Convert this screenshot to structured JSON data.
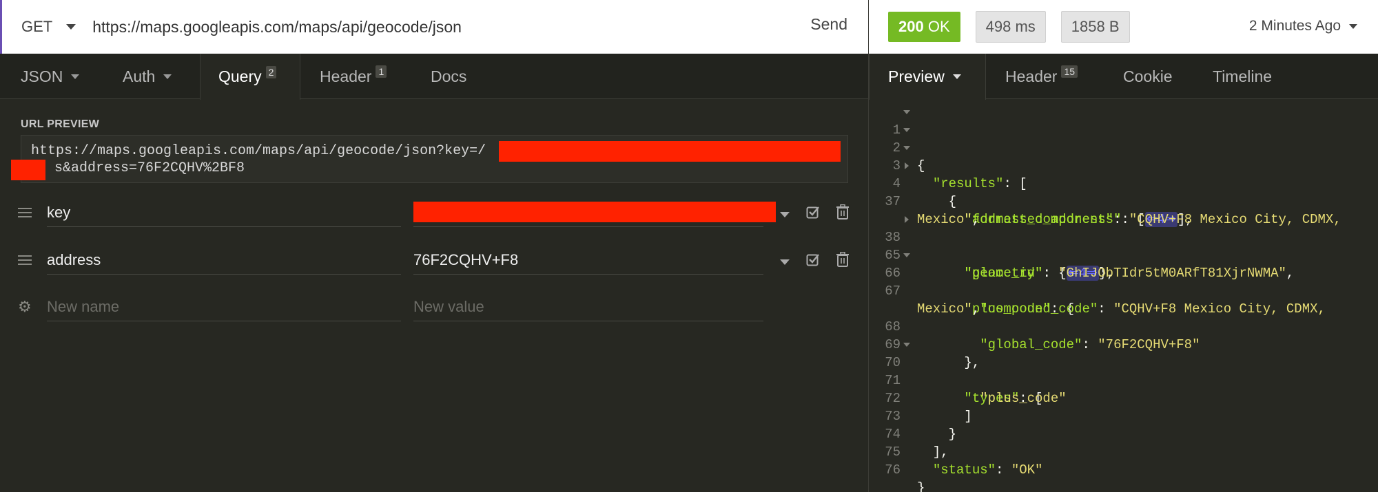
{
  "request": {
    "method": "GET",
    "url": "https://maps.googleapis.com/maps/api/geocode/json",
    "send_label": "Send"
  },
  "response_meta": {
    "status_code": "200",
    "status_text": "OK",
    "time": "498 ms",
    "size": "1858 B",
    "time_ago": "2 Minutes Ago"
  },
  "left_tabs": {
    "json": "JSON",
    "auth": "Auth",
    "query": "Query",
    "query_count": "2",
    "header": "Header",
    "header_count": "1",
    "docs": "Docs"
  },
  "url_preview": {
    "label": "URL PREVIEW",
    "line1": "https://maps.googleapis.com/maps/api/geocode/json?key=/",
    "line2": "s&address=76F2CQHV%2BF8"
  },
  "params": [
    {
      "name": "key",
      "value": ""
    },
    {
      "name": "address",
      "value": "76F2CQHV+F8"
    }
  ],
  "new_param": {
    "name_placeholder": "New name",
    "value_placeholder": "New value"
  },
  "right_tabs": {
    "preview": "Preview",
    "header": "Header",
    "header_count": "15",
    "cookie": "Cookie",
    "timeline": "Timeline"
  },
  "colors": {
    "status_ok": "#75ba24",
    "redaction": "#ff2200",
    "json_key": "#a6e22e",
    "json_string": "#e6db74"
  },
  "code": {
    "line_numbers": [
      "1",
      "2",
      "3",
      "4",
      "37",
      "",
      "38",
      "65",
      "66",
      "67",
      "",
      "68",
      "69",
      "70",
      "71",
      "72",
      "73",
      "74",
      "75",
      "76"
    ],
    "brace_open": "{",
    "results_key": "\"results\"",
    "address_components_key": "\"address_components\"",
    "collapsed": "⇐4⇒",
    "formatted_address_key": "\"formatted_address\"",
    "formatted_address_val_1": "\"CQHV+F8 Mexico City, CDMX,",
    "formatted_address_val_2": "Mexico\"",
    "geometry_key": "\"geometry\"",
    "place_id_key": "\"place_id\"",
    "place_id_val": "\"GhIJObTIdr5tM0ARfT81XjrNWMA\"",
    "plus_code_key": "\"plus_code\"",
    "compound_code_key": "\"compound_code\"",
    "compound_code_val_1": "\"CQHV+F8 Mexico City, CDMX,",
    "compound_code_val_2": "Mexico\"",
    "global_code_key": "\"global_code\"",
    "global_code_val": "\"76F2CQHV+F8\"",
    "types_key": "\"types\"",
    "types_val": "\"plus_code\"",
    "status_key": "\"status\"",
    "status_val": "\"OK\""
  }
}
